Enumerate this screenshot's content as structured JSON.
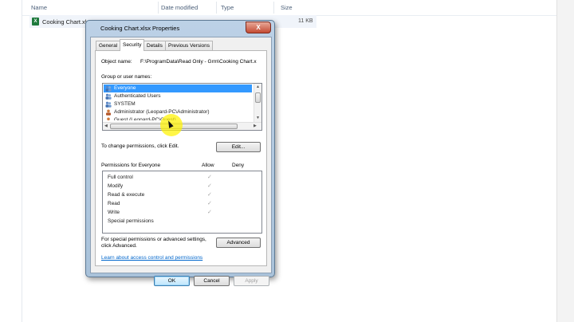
{
  "explorer": {
    "columns": [
      "Name",
      "Date modified",
      "Type",
      "Size"
    ],
    "file": {
      "name": "Cooking Chart.xlsx",
      "size": "11 KB"
    }
  },
  "dialog": {
    "title": "Cooking Chart.xlsx Properties",
    "close_label": "X",
    "tabs": [
      "General",
      "Security",
      "Details",
      "Previous Versions"
    ],
    "active_tab": "Security",
    "object_name_label": "Object name:",
    "object_name_value": "F:\\ProgramData\\Read Only - Grm\\Cooking Chart.x",
    "groups_label": "Group or user names:",
    "groups": [
      {
        "name": "Everyone",
        "icon": "users-icon",
        "selected": true
      },
      {
        "name": "Authenticated Users",
        "icon": "users-icon",
        "selected": false
      },
      {
        "name": "SYSTEM",
        "icon": "users-icon",
        "selected": false
      },
      {
        "name": "Administrator (Leopard-PC\\Administrator)",
        "icon": "user-icon",
        "selected": false
      },
      {
        "name": "Guest (Leopard-PC\\Guest)",
        "icon": "user-icon",
        "selected": false
      }
    ],
    "change_permissions_text": "To change permissions, click Edit.",
    "edit_label": "Edit...",
    "permissions_for_label": "Permissions for Everyone",
    "allow_label": "Allow",
    "deny_label": "Deny",
    "permissions": [
      {
        "name": "Full control",
        "allow": true,
        "deny": false
      },
      {
        "name": "Modify",
        "allow": true,
        "deny": false
      },
      {
        "name": "Read & execute",
        "allow": true,
        "deny": false
      },
      {
        "name": "Read",
        "allow": true,
        "deny": false
      },
      {
        "name": "Write",
        "allow": true,
        "deny": false
      },
      {
        "name": "Special permissions",
        "allow": false,
        "deny": false
      }
    ],
    "special_text_line1": "For special permissions or advanced settings,",
    "special_text_line2": "click Advanced.",
    "advanced_label": "Advanced",
    "learn_link": "Learn about access control and permissions",
    "ok_label": "OK",
    "cancel_label": "Cancel",
    "apply_label": "Apply",
    "check_glyph": "✓",
    "colors": {
      "selection": "#3399ff",
      "link": "#0066cc",
      "highlight": "#fff200"
    }
  }
}
